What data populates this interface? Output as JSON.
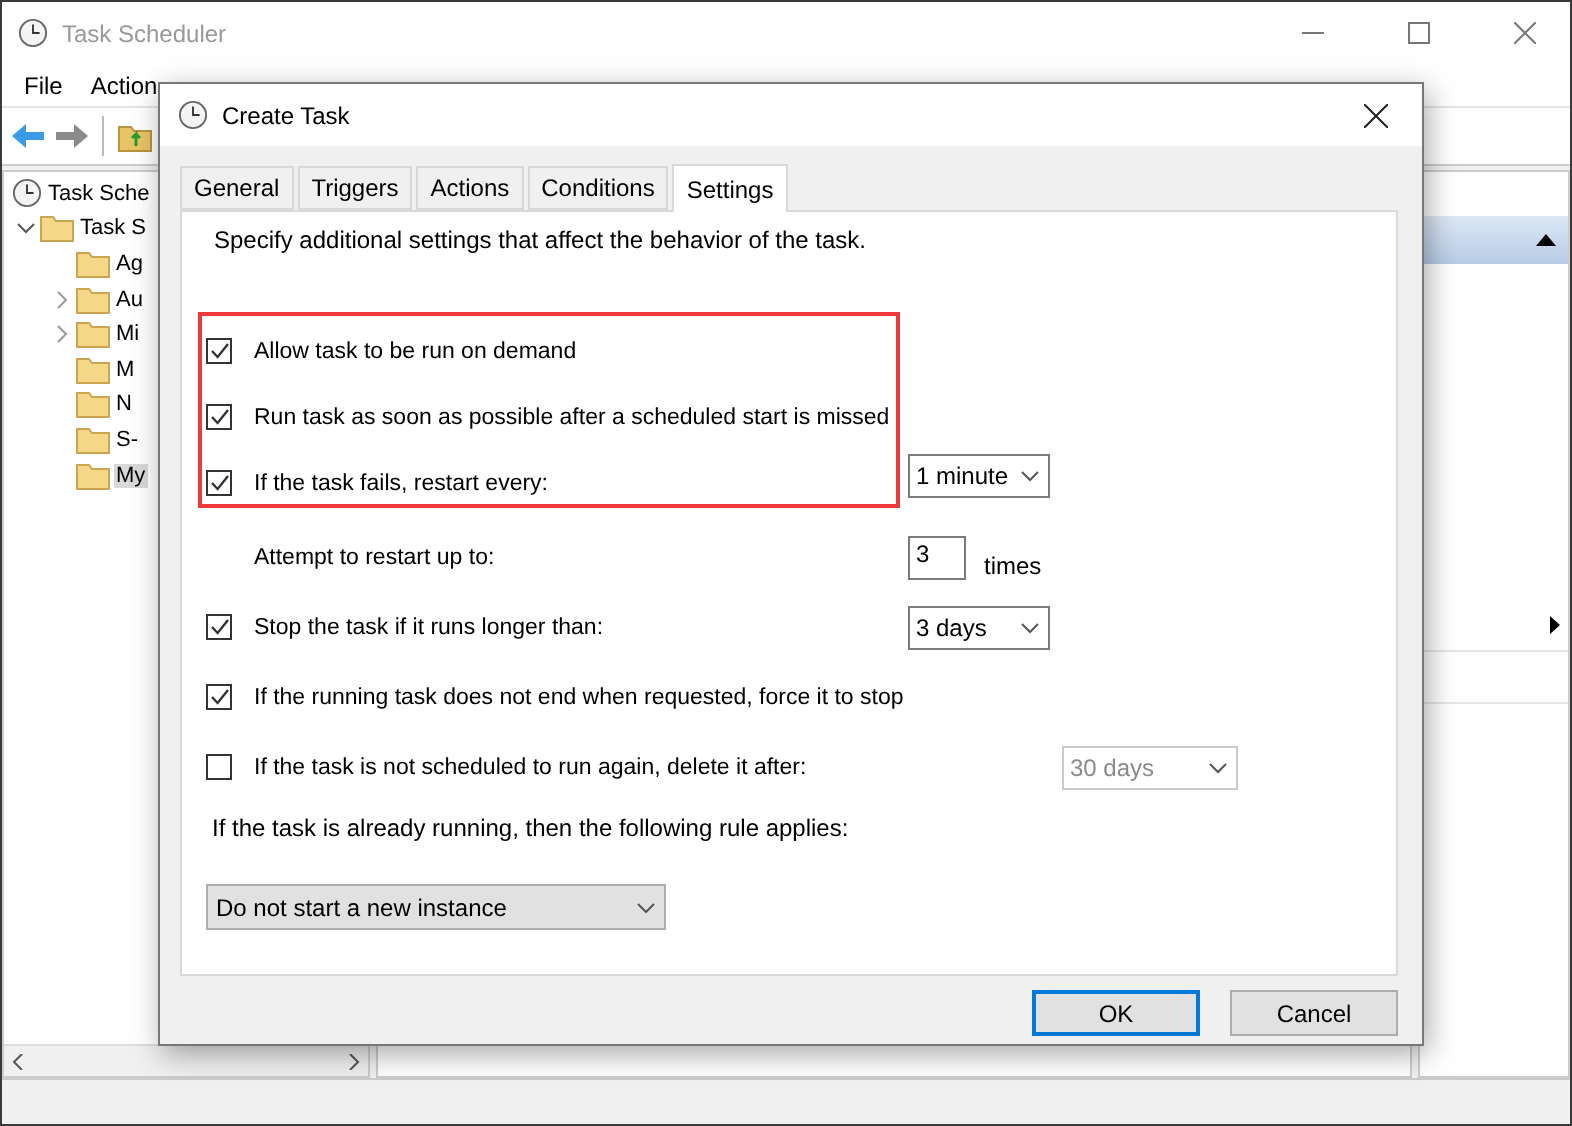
{
  "main_window": {
    "title": "Task Scheduler",
    "menu": [
      "File",
      "Action"
    ],
    "tree": {
      "root": "Task Sche",
      "library": "Task S",
      "folders": [
        {
          "label": "Ag",
          "has_children": false,
          "selected": false
        },
        {
          "label": "Au",
          "has_children": true,
          "selected": false
        },
        {
          "label": "Mi",
          "has_children": true,
          "selected": false
        },
        {
          "label": "M",
          "has_children": false,
          "selected": false
        },
        {
          "label": "N",
          "has_children": false,
          "selected": false
        },
        {
          "label": "S-",
          "has_children": false,
          "selected": false
        },
        {
          "label": "My",
          "has_children": false,
          "selected": true
        }
      ]
    }
  },
  "dialog": {
    "title": "Create Task",
    "tabs": [
      {
        "label": "General",
        "selected": false
      },
      {
        "label": "Triggers",
        "selected": false
      },
      {
        "label": "Actions",
        "selected": false
      },
      {
        "label": "Conditions",
        "selected": false
      },
      {
        "label": "Settings",
        "selected": true
      }
    ],
    "description": "Specify additional settings that affect the behavior of the task.",
    "highlighted_options": [
      {
        "kind": "checkbox",
        "label": "Allow task to be run on demand",
        "checked": true
      },
      {
        "kind": "checkbox",
        "label": "Run task as soon as possible after a scheduled start is missed",
        "checked": true
      },
      {
        "kind": "checkbox",
        "label": "If the task fails, restart every:",
        "checked": true
      }
    ],
    "options": [
      {
        "kind": "text",
        "label": "Attempt to restart up to:",
        "control": {
          "kind": "spin",
          "value": "3",
          "suffix": "times"
        }
      },
      {
        "kind": "checkbox",
        "label": "Stop the task if it runs longer than:",
        "checked": true,
        "control": {
          "kind": "dropdown",
          "value": "3 days",
          "disabled": false
        }
      },
      {
        "kind": "checkbox",
        "label": "If the running task does not end when requested, force it to stop",
        "checked": true
      },
      {
        "kind": "checkbox",
        "label": "If the task is not scheduled to run again, delete it after:",
        "checked": false,
        "control": {
          "kind": "dropdown",
          "value": "30 days",
          "disabled": true
        }
      }
    ],
    "restart_interval": {
      "value": "1 minute",
      "disabled": false
    },
    "rule_label": "If the task is already running, then the following rule applies:",
    "rule_dropdown": "Do not start a new instance",
    "buttons": [
      {
        "label": "OK",
        "default": true
      },
      {
        "label": "Cancel",
        "default": false
      }
    ]
  }
}
